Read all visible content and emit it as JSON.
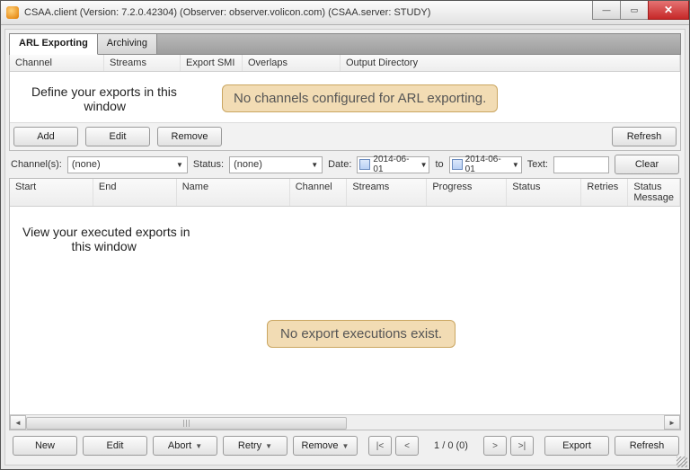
{
  "titlebar": {
    "text": "CSAA.client (Version: 7.2.0.42304) (Observer: observer.volicon.com) (CSAA.server: STUDY)"
  },
  "tabs": {
    "arl": "ARL Exporting",
    "archiving": "Archiving"
  },
  "topgrid": {
    "cols": {
      "channel": "Channel",
      "streams": "Streams",
      "exportsmi": "Export SMI",
      "overlaps": "Overlaps",
      "outputdir": "Output Directory"
    },
    "annot": "Define your exports in this\n               window",
    "callout": "No channels configured for ARL exporting."
  },
  "topbtns": {
    "add": "Add",
    "edit": "Edit",
    "remove": "Remove",
    "refresh": "Refresh"
  },
  "filter": {
    "channels_label": "Channel(s):",
    "channels_value": "(none)",
    "status_label": "Status:",
    "status_value": "(none)",
    "date_label": "Date:",
    "date_from": "2014-06-01",
    "to_label": "to",
    "date_to": "2014-06-01",
    "text_label": "Text:",
    "clear": "Clear"
  },
  "execgrid": {
    "cols": {
      "start": "Start",
      "end": "End",
      "name": "Name",
      "channel": "Channel",
      "streams": "Streams",
      "progress": "Progress",
      "status": "Status",
      "retries": "Retries",
      "statusmsg": "Status Message"
    },
    "annot": "View your executed exports in\n              this window",
    "callout": "No export executions exist."
  },
  "bottom": {
    "new": "New",
    "edit": "Edit",
    "abort": "Abort",
    "retry": "Retry",
    "remove": "Remove",
    "page": "1 / 0 (0)",
    "export": "Export",
    "refresh": "Refresh"
  }
}
